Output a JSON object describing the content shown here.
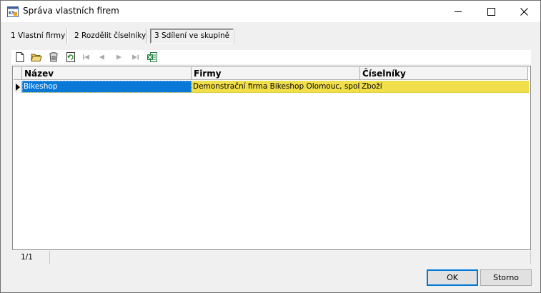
{
  "window": {
    "title": "Správa vlastních firem",
    "app_icon": "ks-app-icon",
    "controls": {
      "minimize": "minimize-icon",
      "maximize": "maximize-icon",
      "close": "close-icon"
    }
  },
  "tabs": [
    {
      "label": "1 Vlastní firmy",
      "active": false
    },
    {
      "label": "2 Rozdělit číselníky",
      "active": false
    },
    {
      "label": "3 Sdílení ve skupině",
      "active": true
    }
  ],
  "toolbar": {
    "buttons": [
      {
        "name": "new-document-icon",
        "enabled": true
      },
      {
        "name": "open-folder-icon",
        "enabled": true
      },
      {
        "name": "delete-bin-icon",
        "enabled": true
      },
      {
        "name": "refresh-icon",
        "enabled": true
      },
      {
        "name": "first-record-icon",
        "enabled": false
      },
      {
        "name": "previous-record-icon",
        "enabled": false
      },
      {
        "name": "next-record-icon",
        "enabled": false
      },
      {
        "name": "last-record-icon",
        "enabled": false
      },
      {
        "name": "excel-export-icon",
        "enabled": true
      }
    ]
  },
  "grid": {
    "columns": [
      "Název",
      "Firmy",
      "Číselníky"
    ],
    "rows": [
      {
        "nazev": "Bikeshop",
        "firmy": "Demonstrační firma Bikeshop Olomouc, spol. s r.o.",
        "ciselniky": "Zboží"
      }
    ],
    "colors": {
      "selection": "#0a78d7",
      "row_highlight": "#f0df4a"
    }
  },
  "status": {
    "position": "1/1"
  },
  "buttons": {
    "ok": "OK",
    "cancel": "Storno"
  }
}
